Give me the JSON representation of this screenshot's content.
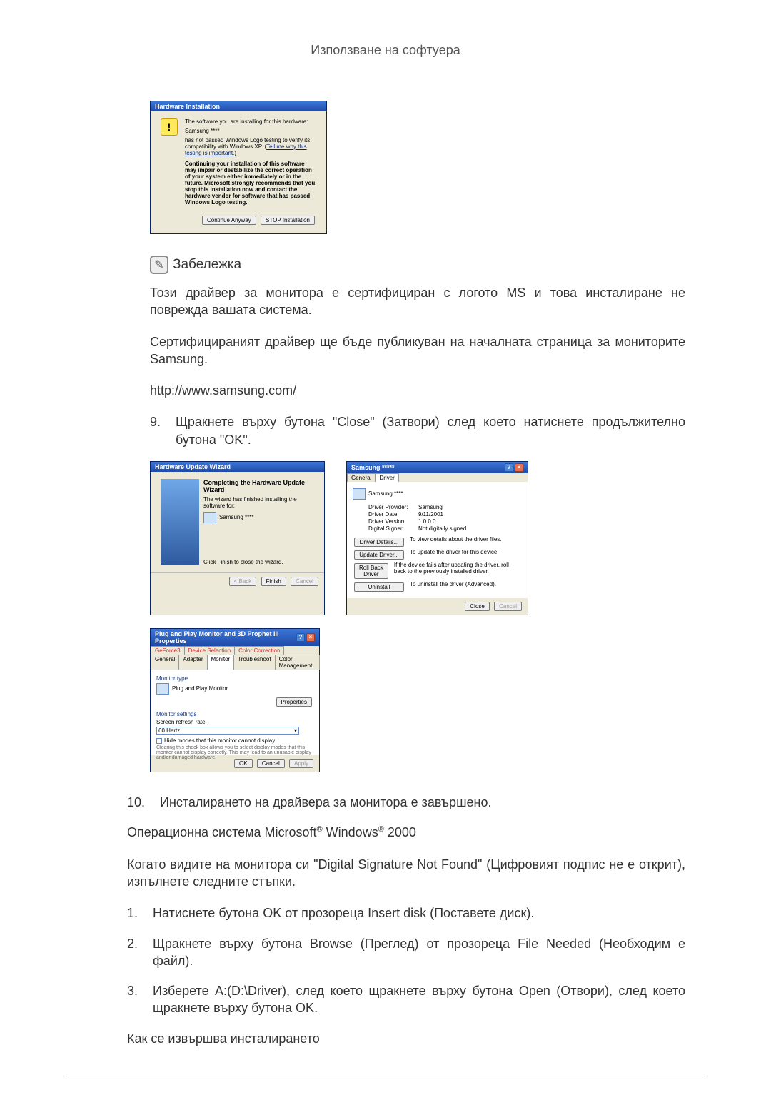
{
  "header": "Използване на софтуера",
  "dialog1": {
    "title": "Hardware Installation",
    "line1": "The software you are installing for this hardware:",
    "device": "Samsung ****",
    "line2a": "has not passed Windows Logo testing to verify its compatibility with Windows XP. (",
    "line2link": "Tell me why this testing is important.",
    "line2b": ")",
    "bold": "Continuing your installation of this software may impair or destabilize the correct operation of your system either immediately or in the future. Microsoft strongly recommends that you stop this installation now and contact the hardware vendor for software that has passed Windows Logo testing.",
    "btn_continue": "Continue Anyway",
    "btn_stop": "STOP Installation"
  },
  "note_label": "Забележка",
  "para1": "Този драйвер за монитора е сертифициран с логото MS и това инсталиране не поврежда вашата система.",
  "para2": "Сертифицираният драйвер ще бъде публикуван на началната страница за мониторите Samsung.",
  "url": "http://www.samsung.com/",
  "step9_num": "9.",
  "step9_text": "Щракнете върху бутона \"Close\" (Затвори) след което натиснете продължително бутона \"OK\".",
  "dialog2": {
    "title": "Hardware Update Wizard",
    "h": "Completing the Hardware Update Wizard",
    "line": "The wizard has finished installing the software for:",
    "device": "Samsung ****",
    "finish_line": "Click Finish to close the wizard.",
    "btn_back": "< Back",
    "btn_finish": "Finish",
    "btn_cancel": "Cancel"
  },
  "dialog3": {
    "title": "Samsung *****",
    "tab_general": "General",
    "tab_driver": "Driver",
    "device": "Samsung ****",
    "rows": {
      "provider_k": "Driver Provider:",
      "provider_v": "Samsung",
      "date_k": "Driver Date:",
      "date_v": "9/11/2001",
      "version_k": "Driver Version:",
      "version_v": "1.0.0.0",
      "signer_k": "Digital Signer:",
      "signer_v": "Not digitally signed"
    },
    "btn_details": "Driver Details...",
    "details_t": "To view details about the driver files.",
    "btn_update": "Update Driver...",
    "update_t": "To update the driver for this device.",
    "btn_rollback": "Roll Back Driver",
    "rollback_t": "If the device fails after updating the driver, roll back to the previously installed driver.",
    "btn_uninstall": "Uninstall",
    "uninstall_t": "To uninstall the driver (Advanced).",
    "btn_close": "Close",
    "btn_cancel": "Cancel"
  },
  "dialog4": {
    "title": "Plug and Play Monitor and 3D Prophet III Properties",
    "tabs_top": [
      "GeForce3",
      "Device Selection",
      "Color Correction"
    ],
    "tabs_bot": [
      "General",
      "Adapter",
      "Monitor",
      "Troubleshoot",
      "Color Management"
    ],
    "mt": "Monitor type",
    "mt_name": "Plug and Play Monitor",
    "btn_props": "Properties",
    "ms": "Monitor settings",
    "sr": "Screen refresh rate:",
    "sr_val": "60 Hertz",
    "cb_label": "Hide modes that this monitor cannot display",
    "cb_hint": "Clearing this check box allows you to select display modes that this monitor cannot display correctly. This may lead to an unusable display and/or damaged hardware.",
    "btn_ok": "OK",
    "btn_cancel": "Cancel",
    "btn_apply": "Apply"
  },
  "step10_num": "10.",
  "step10_text": "Инсталирането на драйвера за монитора е завършено.",
  "os_line_pre": "Операционна система Microsoft",
  "os_line_mid": " Windows",
  "os_line_post": " 2000",
  "para3": "Когато видите на монитора си \"Digital Signature Not Found\" (Цифровият подпис не е открит), изпълнете следните стъпки.",
  "s1_num": "1.",
  "s1_text": "Натиснете бутона OK от прозореца Insert disk (Поставете диск).",
  "s2_num": "2.",
  "s2_text": "Щракнете върху бутона Browse (Преглед) от прозореца File Needed (Необходим е файл).",
  "s3_num": "3.",
  "s3_text": "Изберете A:(D:\\Driver), след което щракнете върху бутона Open (Отвори), след което щракнете върху бутона OK.",
  "howto": "Как се извършва инсталирането"
}
